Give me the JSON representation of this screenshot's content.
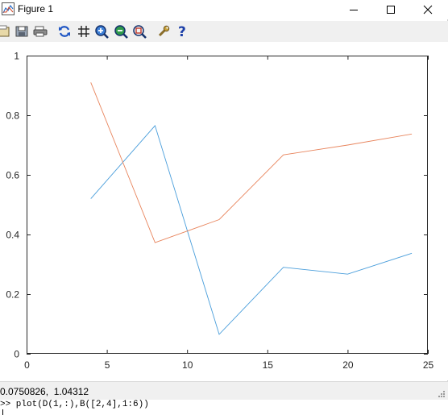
{
  "window": {
    "title": "Figure 1",
    "controls": {
      "minimize": "minimize",
      "maximize": "maximize",
      "close": "close"
    }
  },
  "toolbar": {
    "buttons": [
      {
        "name": "open-file-button",
        "icon": "folder-icon"
      },
      {
        "name": "save-button",
        "icon": "save-icon"
      },
      {
        "name": "print-button",
        "icon": "printer-icon"
      },
      {
        "name": "reset-view-button",
        "icon": "refresh-icon"
      },
      {
        "name": "grid-toggle-button",
        "icon": "grid-icon"
      },
      {
        "name": "zoom-in-button",
        "icon": "zoom-in-icon"
      },
      {
        "name": "zoom-out-button",
        "icon": "zoom-out-icon"
      },
      {
        "name": "zoom-box-button",
        "icon": "zoom-box-icon"
      },
      {
        "name": "settings-button",
        "icon": "wrench-icon"
      },
      {
        "name": "help-button",
        "icon": "help-icon"
      }
    ]
  },
  "status": {
    "coordinates": "0.0750826,  1.04312"
  },
  "console": {
    "command": ">> plot(D(1,:),B([2,4],1:6))"
  },
  "colors": {
    "series1": "#4a9edb",
    "series2": "#e8845c",
    "axis": "#262626"
  },
  "chart_data": {
    "type": "line",
    "title": "",
    "xlabel": "",
    "ylabel": "",
    "xlim": [
      0,
      25
    ],
    "ylim": [
      0,
      1
    ],
    "xticks": [
      "0",
      "5",
      "10",
      "15",
      "20",
      "25"
    ],
    "yticks": [
      "0",
      "0.2",
      "0.4",
      "0.6",
      "0.8",
      "1"
    ],
    "grid": false,
    "x": [
      4,
      8,
      12,
      16,
      20,
      24
    ],
    "series": [
      {
        "values": [
          0.52,
          0.765,
          0.065,
          0.29,
          0.267,
          0.337
        ],
        "color": "#4a9edb"
      },
      {
        "values": [
          0.91,
          0.373,
          0.45,
          0.667,
          0.7,
          0.737
        ],
        "color": "#e8845c"
      }
    ]
  }
}
